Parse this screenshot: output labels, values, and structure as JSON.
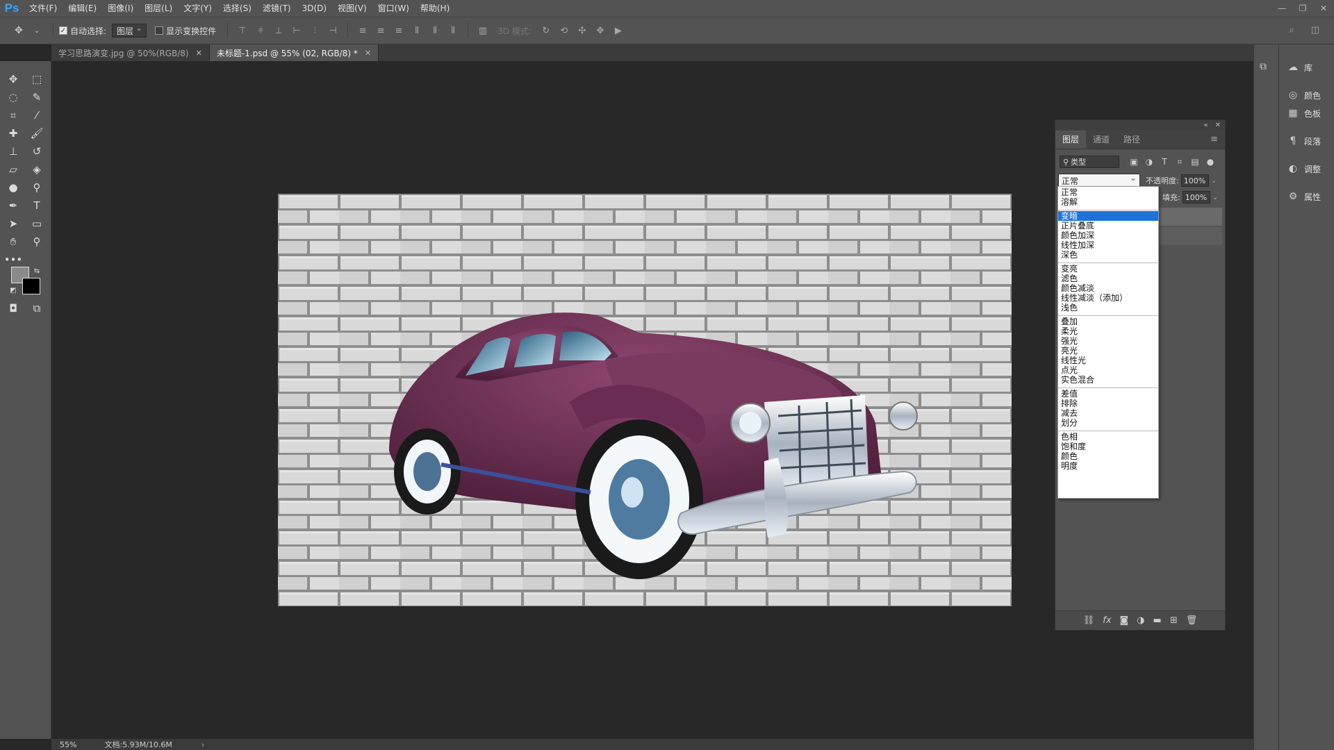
{
  "app": {
    "logo": "Ps"
  },
  "menubar": [
    "文件(F)",
    "编辑(E)",
    "图像(I)",
    "图层(L)",
    "文字(Y)",
    "选择(S)",
    "滤镜(T)",
    "3D(D)",
    "视图(V)",
    "窗口(W)",
    "帮助(H)"
  ],
  "options": {
    "auto_select_label": "自动选择:",
    "auto_select_value": "图层",
    "show_transform_label": "显示变换控件",
    "mode_3d_label": "3D 模式:"
  },
  "tabs": [
    {
      "label": "学习思路演变.jpg @ 50%(RGB/8)"
    },
    {
      "label": "未标题-1.psd @ 55% (02, RGB/8) *"
    }
  ],
  "status": {
    "zoom": "55%",
    "doc_size": "文档:5.93M/10.6M"
  },
  "dock": {
    "items": [
      {
        "label": "库",
        "icon": "library-icon"
      },
      {
        "label": "颜色",
        "icon": "color-icon"
      },
      {
        "label": "色板",
        "icon": "swatches-icon"
      },
      {
        "label": "段落",
        "icon": "paragraph-icon"
      },
      {
        "label": "调整",
        "icon": "adjustments-icon"
      },
      {
        "label": "属性",
        "icon": "properties-icon"
      }
    ]
  },
  "layers_panel": {
    "tabs": [
      "图层",
      "通道",
      "路径"
    ],
    "filter_kind": "类型",
    "blend_mode": "正常",
    "opacity_label": "不透明度:",
    "opacity_value": "100%",
    "fill_label": "填充:",
    "fill_value": "100%"
  },
  "blend_dropdown": {
    "groups": [
      [
        "正常",
        "溶解"
      ],
      [
        "变暗",
        "正片叠底",
        "颜色加深",
        "线性加深",
        "深色"
      ],
      [
        "变亮",
        "滤色",
        "颜色减淡",
        "线性减淡（添加）",
        "浅色"
      ],
      [
        "叠加",
        "柔光",
        "强光",
        "亮光",
        "线性光",
        "点光",
        "实色混合"
      ],
      [
        "差值",
        "排除",
        "减去",
        "划分"
      ],
      [
        "色相",
        "饱和度",
        "颜色",
        "明度"
      ]
    ],
    "selected": "变暗"
  },
  "colors": {
    "car_body": "#6e2f52",
    "brick": "#d2d2d2",
    "mortar": "#8a8a8a",
    "selection": "#1e73d8"
  }
}
